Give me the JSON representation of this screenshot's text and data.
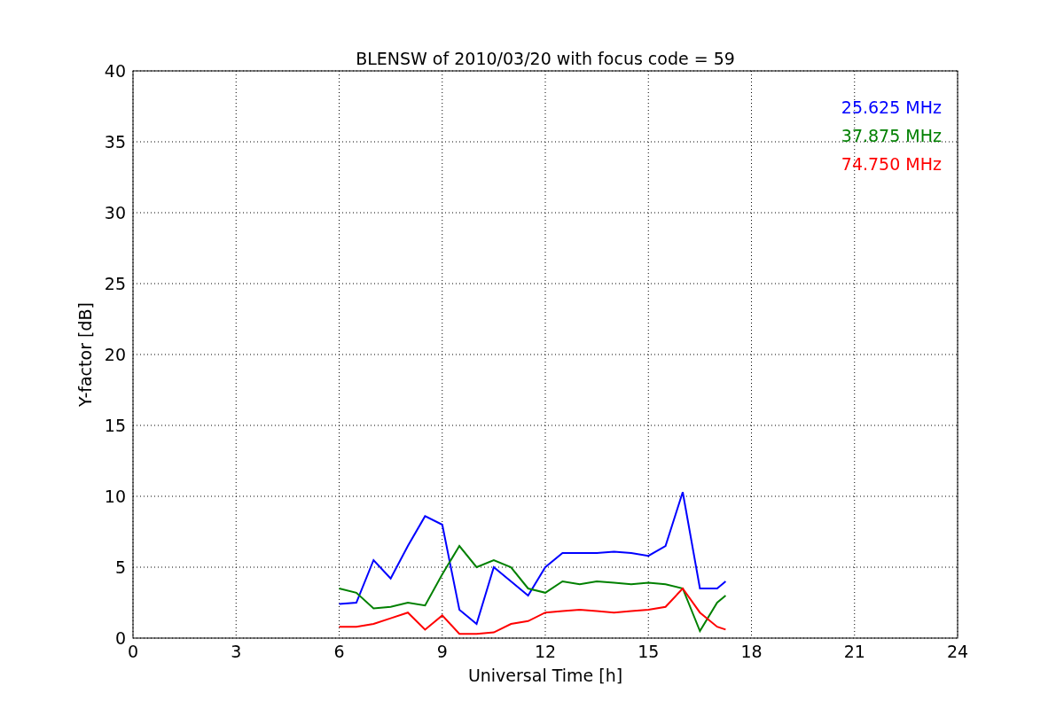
{
  "figure": {
    "chart_data": {
      "type": "line",
      "title": "BLENSW of 2010/03/20 with focus code = 59",
      "xlabel": "Universal Time [h]",
      "ylabel": "Y-factor [dB]",
      "x": [
        6,
        6.5,
        7,
        7.5,
        8,
        8.5,
        9,
        9.5,
        10,
        10.5,
        11,
        11.5,
        12,
        12.5,
        13,
        13.5,
        14,
        14.5,
        15,
        15.5,
        16,
        16.5,
        17,
        17.25
      ],
      "series": [
        {
          "name": "25.625 MHz",
          "color": "#0000ff",
          "values": [
            2.4,
            2.5,
            5.5,
            4.2,
            6.5,
            8.6,
            8.0,
            2.0,
            1.0,
            5.0,
            4.0,
            3.0,
            5.0,
            6.0,
            6.0,
            6.0,
            6.1,
            6.0,
            5.8,
            6.5,
            10.3,
            3.5,
            3.5,
            4.0
          ]
        },
        {
          "name": "37.875 MHz",
          "color": "#008000",
          "values": [
            3.5,
            3.2,
            2.1,
            2.2,
            2.5,
            2.3,
            4.5,
            6.5,
            5.0,
            5.5,
            5.0,
            3.5,
            3.2,
            4.0,
            3.8,
            4.0,
            3.9,
            3.8,
            3.9,
            3.8,
            3.5,
            0.5,
            2.5,
            3.0
          ]
        },
        {
          "name": "74.750 MHz",
          "color": "#ff0000",
          "values": [
            0.8,
            0.8,
            1.0,
            1.4,
            1.8,
            0.6,
            1.6,
            0.3,
            0.3,
            0.4,
            1.0,
            1.2,
            1.8,
            1.9,
            2.0,
            1.9,
            1.8,
            1.9,
            2.0,
            2.2,
            3.5,
            1.8,
            0.8,
            0.6
          ]
        }
      ],
      "xlim": [
        0,
        24
      ],
      "ylim": [
        0,
        40
      ],
      "xticks": [
        0,
        3,
        6,
        9,
        12,
        15,
        18,
        21,
        24
      ],
      "yticks": [
        0,
        5,
        10,
        15,
        20,
        25,
        30,
        35,
        40
      ],
      "grid": true
    }
  }
}
